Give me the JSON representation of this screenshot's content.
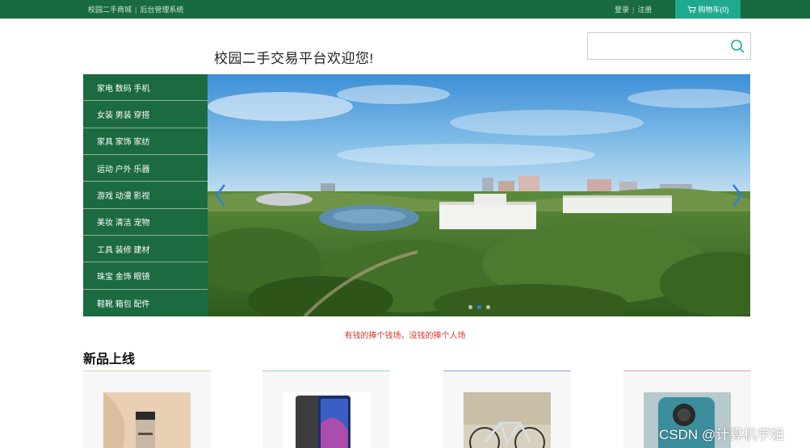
{
  "topbar": {
    "site_name": "校园二手商城",
    "admin_link": "后台管理系统",
    "login": "登录",
    "register": "注册",
    "cart_label": "购物车(0)"
  },
  "header": {
    "welcome": "校园二手交易平台欢迎您!",
    "search_placeholder": ""
  },
  "categories": [
    "家电 数码 手机",
    "女装 男装 穿搭",
    "家具 家饰 家纺",
    "运动 户外 乐器",
    "游戏 动漫 影视",
    "美妆 清洁 宠物",
    "工具 装修 建材",
    "珠宝 金饰 眼镜",
    "鞋靴 箱包 配件"
  ],
  "carousel": {
    "slide_count": 3,
    "active_index": 1
  },
  "slogan": "有钱的捧个钱场，没钱的捧个人场",
  "new_products": {
    "title": "新品上线",
    "items": [
      {
        "image": "foundation-bottle",
        "accent": "#c8d8b0"
      },
      {
        "image": "smartphone",
        "accent": "#9fd6c9"
      },
      {
        "image": "bicycle",
        "accent": "#8aa1d9"
      },
      {
        "image": "phone-case",
        "accent": "#e3a1a8"
      }
    ]
  },
  "watermark": "CSDN @计算机学姐",
  "colors": {
    "brand_green": "#176b3e",
    "cart_teal": "#1fa98e",
    "slogan_red": "#d9362b"
  }
}
